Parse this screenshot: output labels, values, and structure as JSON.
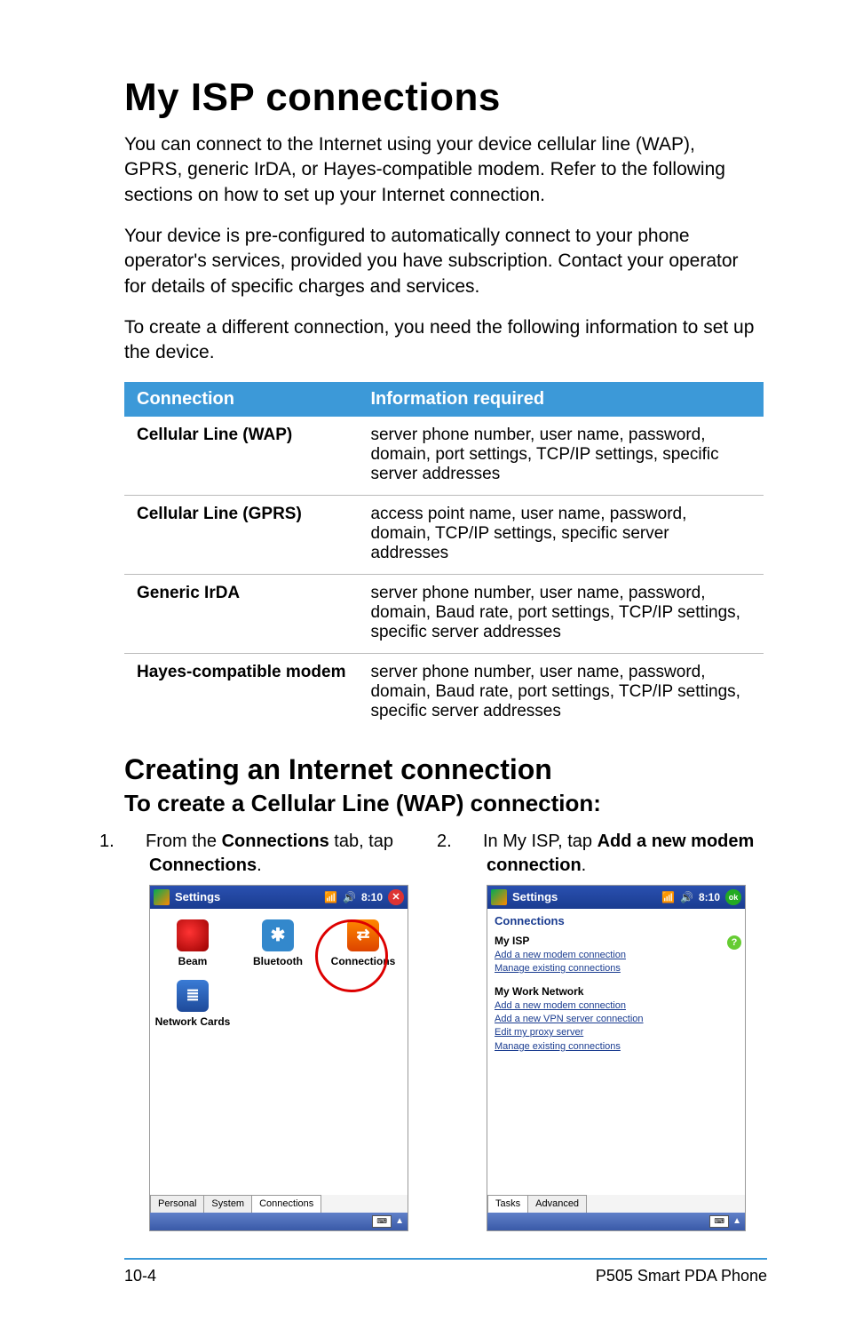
{
  "title": "My ISP connections",
  "paragraphs": [
    "You can connect to the Internet using your device cellular line (WAP), GPRS, generic IrDA, or Hayes-compatible modem. Refer to the following sections on how to set up your Internet connection.",
    "Your device is pre-configured to automatically connect to your phone operator's services, provided you have subscription. Contact your operator for details of specific charges and services.",
    "To create a different connection, you need the following information to set up the device."
  ],
  "table": {
    "headers": [
      "Connection",
      "Information required"
    ],
    "rows": [
      {
        "conn": "Cellular Line (WAP)",
        "info": "server phone number, user name, password, domain, port settings, TCP/IP settings, specific server addresses"
      },
      {
        "conn": "Cellular Line (GPRS)",
        "info": "access point name, user name, password, domain, TCP/IP settings, specific server addresses"
      },
      {
        "conn": "Generic IrDA",
        "info": "server phone number, user name, password, domain, Baud rate, port settings, TCP/IP settings, specific server addresses"
      },
      {
        "conn": "Hayes-compatible modem",
        "info": "server phone number, user name, password, domain, Baud rate, port settings, TCP/IP settings, specific server addresses"
      }
    ]
  },
  "subtitle": "Creating an Internet connection",
  "procedure_title": "To create a Cellular Line (WAP) connection:",
  "steps": [
    {
      "num": "1.",
      "pre": "From the ",
      "bold1": "Connections",
      "mid": " tab, tap ",
      "bold2": "Connections",
      "post": "."
    },
    {
      "num": "2.",
      "pre": "In My ISP, tap ",
      "bold1": "Add a new modem connection",
      "mid": "",
      "bold2": "",
      "post": "."
    }
  ],
  "screenshot1": {
    "title": "Settings",
    "time": "8:10",
    "icons": [
      {
        "label": "Beam",
        "type": "beam"
      },
      {
        "label": "Bluetooth",
        "type": "bt"
      },
      {
        "label": "Connections",
        "type": "conn"
      },
      {
        "label": "Network Cards",
        "type": "net"
      }
    ],
    "tabs": [
      "Personal",
      "System",
      "Connections"
    ],
    "active_tab": 2
  },
  "screenshot2": {
    "title": "Settings",
    "time": "8:10",
    "header": "Connections",
    "groups": [
      {
        "title": "My ISP",
        "links": [
          "Add a new modem connection",
          "Manage existing connections"
        ]
      },
      {
        "title": "My Work Network",
        "links": [
          "Add a new modem connection",
          "Add a new VPN server connection",
          "Edit my proxy server",
          "Manage existing connections"
        ]
      }
    ],
    "tabs": [
      "Tasks",
      "Advanced"
    ],
    "active_tab": 0
  },
  "footer": {
    "left": "10-4",
    "right": "P505 Smart PDA Phone"
  }
}
